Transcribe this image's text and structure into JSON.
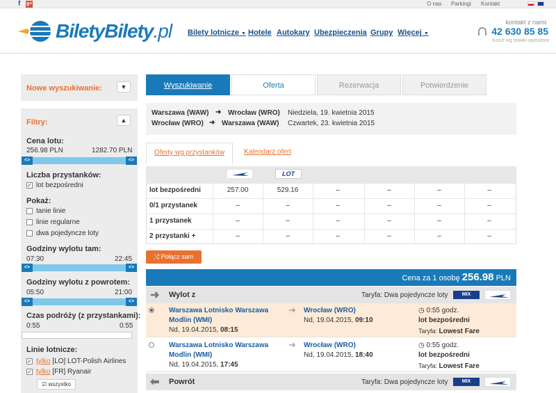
{
  "topbar": {
    "links": [
      "O nas",
      "Parkingi",
      "Kontakt"
    ]
  },
  "header": {
    "logo_main": "BiletyBilety",
    "logo_suffix": ".pl",
    "nav": [
      "Bilety lotnicze",
      "Hotele",
      "Autokary",
      "Ubezpieczenia",
      "Grupy",
      "Więcej"
    ],
    "contact_label": "kontakt z nami:",
    "phone": "42 630 85 85",
    "cost_note": "Koszt wg stawki operatora"
  },
  "sidebar": {
    "new_search": "Nowe wyszukiwanie:",
    "filters_title": "Filtry:",
    "price_label": "Cena lotu:",
    "price_min": "256.98 PLN",
    "price_max": "1282.70 PLN",
    "stops_label": "Liczba przystanków:",
    "stops_option": "lot bezpośredni",
    "show_label": "Pokaż:",
    "show_options": [
      "tanie linie",
      "linie regularne",
      "dwa pojedyncze loty"
    ],
    "dep_label": "Godziny wylotu tam:",
    "dep_from": "07:30",
    "dep_to": "22:45",
    "ret_label": "Godziny wylotu z powrotem:",
    "ret_from": "05:50",
    "ret_to": "21:00",
    "dur_label": "Czas podróży (z przystankami):",
    "dur_from": "0:55",
    "dur_to": "0:55",
    "airlines_label": "Linie lotnicze:",
    "airline_only": "tylko",
    "airlines": [
      "[LO] LOT-Polish Airlines",
      "[FR] Ryanair"
    ],
    "all_button": "wszystko"
  },
  "tabs": [
    "Wyszukiwanie",
    "Oferta",
    "Rezerwacja",
    "Potwierdzenie"
  ],
  "route": [
    {
      "from": "Warszawa (WAW)",
      "to": "Wrocław (WRO)",
      "date": "Niedziela, 19. kwietnia 2015"
    },
    {
      "from": "Wrocław (WRO)",
      "to": "Warszawa (WAW)",
      "date": "Czwartek, 23. kwietnia 2015"
    }
  ],
  "subtabs": [
    "Oferty wg przystanków",
    "Kalendarz ofert"
  ],
  "grid": {
    "airline_logo": "LOT",
    "rows": [
      {
        "label": "lot bezpośredni",
        "cells": [
          "257.00",
          "529.16",
          "–",
          "–",
          "–",
          "–"
        ]
      },
      {
        "label": "0/1 przystanek",
        "cells": [
          "–",
          "–",
          "–",
          "–",
          "–",
          "–"
        ]
      },
      {
        "label": "1 przystanek",
        "cells": [
          "–",
          "–",
          "–",
          "–",
          "–",
          "–"
        ]
      },
      {
        "label": "2 przystanki +",
        "cells": [
          "–",
          "–",
          "–",
          "–",
          "–",
          "–"
        ]
      }
    ]
  },
  "combine_button": "Połącz sam",
  "price": {
    "label": "Cena za 1 osobę",
    "amount": "256.98",
    "currency": "PLN"
  },
  "outbound": {
    "title": "Wylot z",
    "tariff": "Taryfa: Dwa pojedyncze loty",
    "mix": "MIX",
    "flights": [
      {
        "from_a": "Warszawa Lotnisko Warszawa",
        "from_b": "Modlin (WMI)",
        "dep_date": "Nd, 19.04.2015,",
        "dep_time": "08:15",
        "to": "Wrocław (WRO)",
        "arr_date": "Nd, 19.04.2015,",
        "arr_time": "09:10",
        "duration": "0:55 godz.",
        "stops": "lot bezpośredni",
        "fare_label": "Taryfa:",
        "fare": "Lowest Fare"
      },
      {
        "from_a": "Warszawa Lotnisko Warszawa",
        "from_b": "Modlin (WMI)",
        "dep_date": "Nd, 19.04.2015,",
        "dep_time": "17:45",
        "to": "Wrocław (WRO)",
        "arr_date": "Nd, 19.04.2015,",
        "arr_time": "18:40",
        "duration": "0:55 godz.",
        "stops": "lot bezpośredni",
        "fare_label": "Taryfa:",
        "fare": "Lowest Fare"
      }
    ]
  },
  "return": {
    "title": "Powrót",
    "tariff": "Taryfa: Dwa pojedyncze loty",
    "mix": "MIX"
  }
}
